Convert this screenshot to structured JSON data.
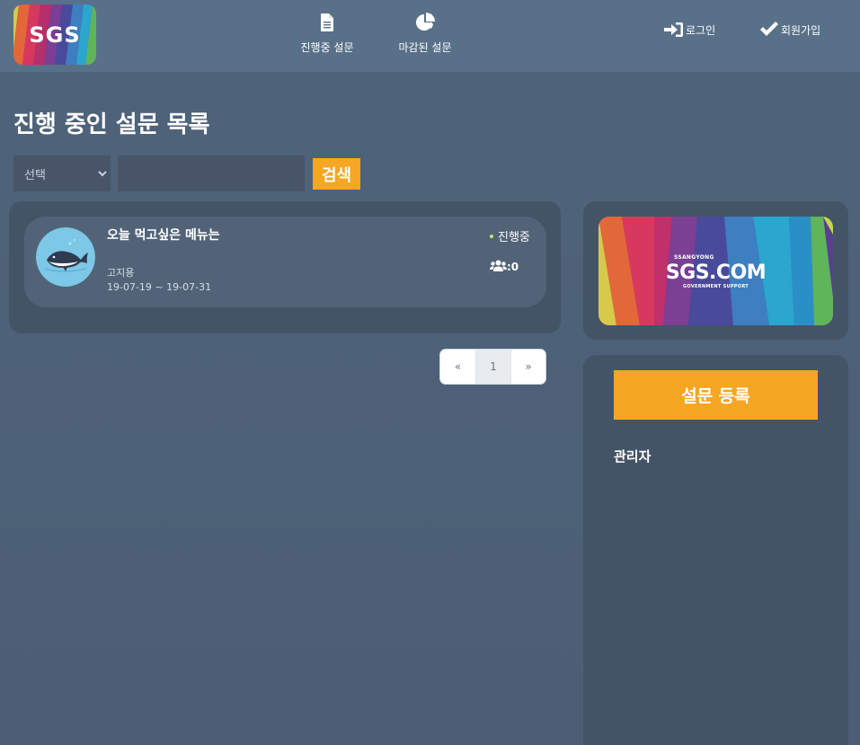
{
  "header": {
    "logo_text": "SGS",
    "nav": [
      {
        "label": "진행중 설문",
        "icon": "document-icon"
      },
      {
        "label": "마감된 설문",
        "icon": "pie-chart-icon"
      }
    ],
    "auth": [
      {
        "label": "로그인",
        "icon": "sign-in-icon"
      },
      {
        "label": "회원가입",
        "icon": "check-icon"
      }
    ]
  },
  "main": {
    "title": "진행 중인 설문 목록",
    "search": {
      "select_value": "선택",
      "input_value": "",
      "button_label": "검색"
    },
    "surveys": [
      {
        "title": "오늘 먹고싶은 메뉴는",
        "author": "고지용",
        "dates": "19-07-19 ~ 19-07-31",
        "status": "진행중",
        "count": ":0",
        "avatar_icon": "whale-icon"
      }
    ],
    "pagination": {
      "prev": "«",
      "pages": [
        "1"
      ],
      "next": "»",
      "current": "1"
    }
  },
  "sidebar": {
    "banner": {
      "small": "SSANGYONG",
      "big": "SGS.COM",
      "sub": "GOVERNMENT SUPPORT"
    },
    "register_label": "설문 등록",
    "admin_label": "관리자"
  },
  "colors": {
    "accent": "#f5a623",
    "header_bg": "#587189",
    "panel_bg": "#445467",
    "card_bg": "#526378",
    "status_dot": "#c5e86c"
  }
}
